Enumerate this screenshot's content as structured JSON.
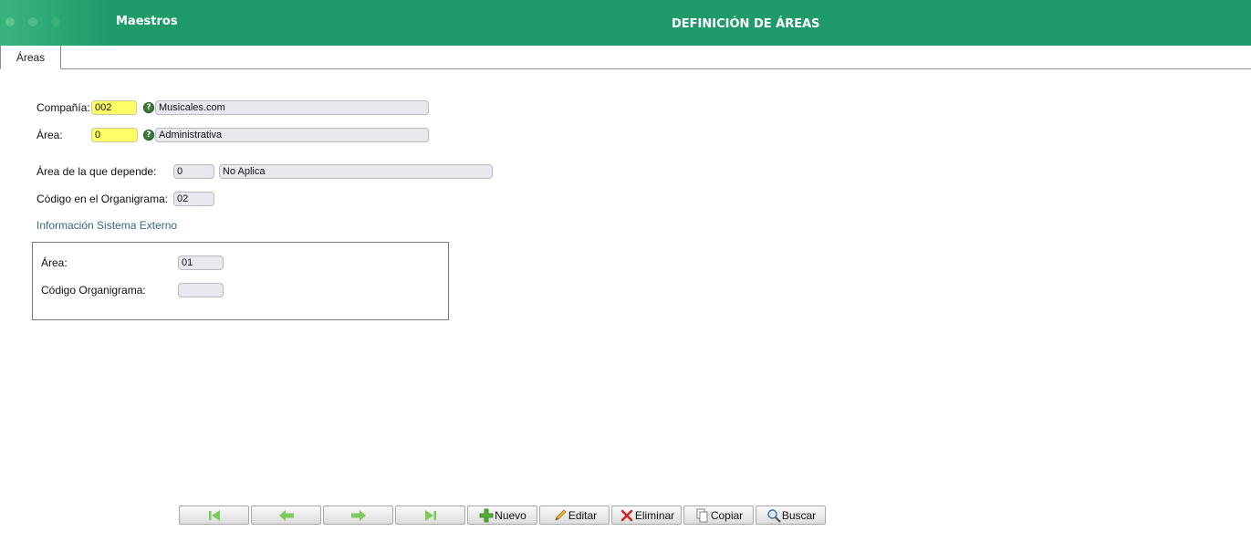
{
  "header": {
    "app_title": "Maestros",
    "page_title": "DEFINICIÓN DE ÁREAS"
  },
  "tabs": [
    {
      "label": "Áreas"
    }
  ],
  "form": {
    "compania": {
      "label": "Compañía:",
      "code": "002",
      "name": "Musicales.com"
    },
    "area": {
      "label": "Área:",
      "code": "0",
      "name": "Administrativa"
    },
    "area_depende": {
      "label": "Área de la que depende:",
      "code": "0",
      "name": "No Aplica"
    },
    "codigo_organigrama": {
      "label": "Código en el Organigrama:",
      "value": "02"
    }
  },
  "sistema_externo": {
    "title": "Información Sistema Externo",
    "area": {
      "label": "Área:",
      "value": "01"
    },
    "codigo_organigrama": {
      "label": "Código Organigrama:",
      "value": ""
    }
  },
  "toolbar": {
    "first": {
      "icon": "first-record-icon"
    },
    "prev": {
      "icon": "previous-arrow-icon"
    },
    "next": {
      "icon": "next-arrow-icon"
    },
    "last": {
      "icon": "last-record-icon"
    },
    "nuevo": {
      "label": "Nuevo",
      "icon": "plus-icon"
    },
    "editar": {
      "label": "Editar",
      "icon": "pencil-icon"
    },
    "eliminar": {
      "label": "Eliminar",
      "icon": "x-icon"
    },
    "copiar": {
      "label": "Copiar",
      "icon": "copy-icon"
    },
    "buscar": {
      "label": "Buscar",
      "icon": "magnifier-icon"
    }
  },
  "colors": {
    "header": "#1f9a6a",
    "required_field": "#ffff66",
    "readonly_field": "#e8e8ef",
    "nav_arrow": "#7dc95a"
  }
}
